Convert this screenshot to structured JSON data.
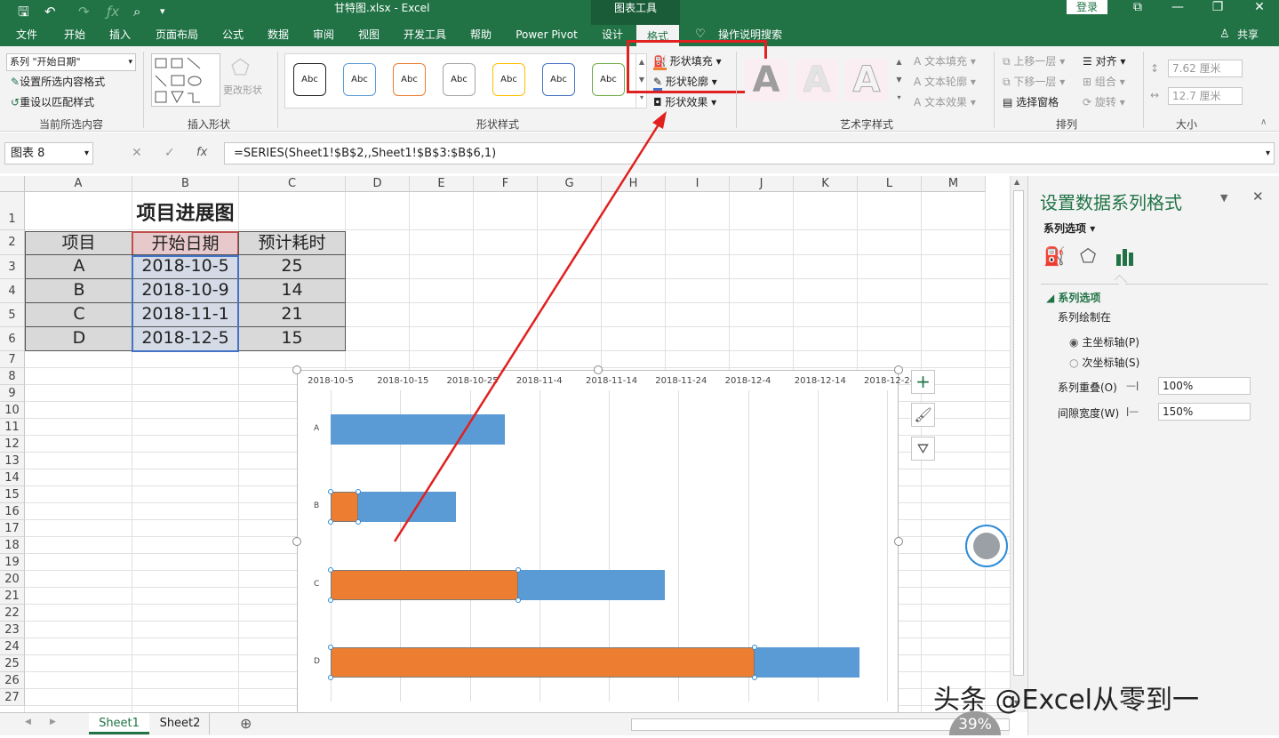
{
  "titlebar": {
    "filename": "甘特图.xlsx",
    "sep": "-",
    "app": "Excel",
    "context_tools": "图表工具",
    "login": "登录"
  },
  "tabs": [
    "文件",
    "开始",
    "插入",
    "页面布局",
    "公式",
    "数据",
    "审阅",
    "视图",
    "开发工具",
    "帮助",
    "Power Pivot",
    "设计",
    "格式"
  ],
  "tell_me": "操作说明搜索",
  "share": "共享",
  "ribbon": {
    "current_selection": {
      "dropdown": "系列 \"开始日期\"",
      "format_selection": "设置所选内容格式",
      "reset_style": "重设以匹配样式",
      "label": "当前所选内容"
    },
    "insert_shapes": {
      "change_shape": "更改形状",
      "label": "插入形状"
    },
    "shape_styles": {
      "sample": "Abc",
      "fill": "形状填充",
      "outline": "形状轮廓",
      "effects": "形状效果",
      "label": "形状样式"
    },
    "wordart": {
      "letter": "A",
      "fill": "文本填充",
      "outline": "文本轮廓",
      "effects": "文本效果",
      "label": "艺术字样式"
    },
    "arrange": {
      "bring_forward": "上移一层",
      "send_backward": "下移一层",
      "selection_pane": "选择窗格",
      "align": "对齐",
      "group": "组合",
      "rotate": "旋转",
      "label": "排列"
    },
    "size": {
      "height": "7.62 厘米",
      "width": "12.7 厘米",
      "label": "大小"
    }
  },
  "formula_bar": {
    "name_box": "图表 8",
    "fx": "fx",
    "formula": "=SERIES(Sheet1!$B$2,,Sheet1!$B$3:$B$6,1)"
  },
  "columns": [
    "A",
    "B",
    "C",
    "D",
    "E",
    "F",
    "G",
    "H",
    "I",
    "J",
    "K",
    "L",
    "M"
  ],
  "rows": [
    "1",
    "2",
    "3",
    "4",
    "5",
    "6",
    "7",
    "8",
    "9",
    "10",
    "11",
    "12",
    "13",
    "14",
    "15",
    "16",
    "17",
    "18",
    "19",
    "20",
    "21",
    "22",
    "23",
    "24",
    "25",
    "26",
    "27"
  ],
  "sheet": {
    "title": "项目进展图",
    "headers": [
      "项目",
      "开始日期",
      "预计耗时"
    ],
    "data": [
      [
        "A",
        "2018-10-5",
        "25"
      ],
      [
        "B",
        "2018-10-9",
        "14"
      ],
      [
        "C",
        "2018-11-1",
        "21"
      ],
      [
        "D",
        "2018-12-5",
        "15"
      ]
    ]
  },
  "chart_data": {
    "type": "bar",
    "orientation": "horizontal",
    "stacked": true,
    "categories": [
      "A",
      "B",
      "C",
      "D"
    ],
    "series": [
      {
        "name": "开始日期",
        "color": "#ed7d31",
        "values": [
          "2018-10-5",
          "2018-10-9",
          "2018-11-1",
          "2018-12-5"
        ]
      },
      {
        "name": "预计耗时",
        "color": "#5b9bd5",
        "values": [
          25,
          14,
          21,
          15
        ]
      }
    ],
    "x_ticks": [
      "2018-10-5",
      "2018-10-15",
      "2018-10-25",
      "2018-11-4",
      "2018-11-14",
      "2018-11-24",
      "2018-12-4",
      "2018-12-14",
      "2018-12-24"
    ],
    "xlim": [
      "2018-10-5",
      "2018-12-24"
    ],
    "x_axis_position": "top",
    "grid": true
  },
  "panel": {
    "title": "设置数据系列格式",
    "options_label": "系列选项",
    "section": "系列选项",
    "plot_on": "系列绘制在",
    "primary": "主坐标轴(P)",
    "secondary": "次坐标轴(S)",
    "overlap_label": "系列重叠(O)",
    "overlap": "100%",
    "gap_label": "间隙宽度(W)",
    "gap": "150%"
  },
  "sheets": [
    "Sheet1",
    "Sheet2"
  ],
  "watermark": "头条 @Excel从零到一",
  "zoom_badge": "39%"
}
